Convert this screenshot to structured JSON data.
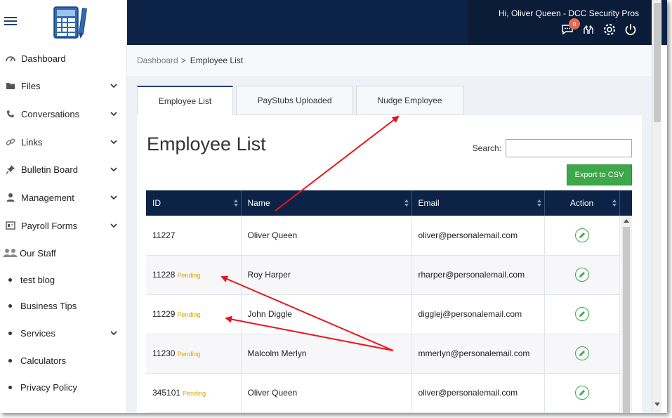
{
  "header": {
    "greeting": "Hi, Oliver Queen - DCC Security Pros",
    "notification_count": "0",
    "icons": [
      "chat-icon",
      "hands-icon",
      "gear-icon",
      "power-icon"
    ]
  },
  "sidebar": {
    "items": [
      {
        "label": "Dashboard",
        "icon": "gauge-icon",
        "has_chevron": false
      },
      {
        "label": "Files",
        "icon": "folder-icon",
        "has_chevron": true
      },
      {
        "label": "Conversations",
        "icon": "phone-icon",
        "has_chevron": true
      },
      {
        "label": "Links",
        "icon": "link-icon",
        "has_chevron": true
      },
      {
        "label": "Bulletin Board",
        "icon": "pin-icon",
        "has_chevron": true
      },
      {
        "label": "Management",
        "icon": "user-icon",
        "has_chevron": true
      },
      {
        "label": "Payroll Forms",
        "icon": "form-icon",
        "has_chevron": true
      },
      {
        "label": "Our Staff",
        "icon": "staff-icon",
        "has_chevron": false
      },
      {
        "label": "test blog",
        "icon": "bullet",
        "has_chevron": false
      },
      {
        "label": "Business Tips",
        "icon": "bullet",
        "has_chevron": false
      },
      {
        "label": "Services",
        "icon": "bullet",
        "has_chevron": true
      },
      {
        "label": "Calculators",
        "icon": "bullet",
        "has_chevron": false
      },
      {
        "label": "Privacy Policy",
        "icon": "bullet",
        "has_chevron": false
      }
    ]
  },
  "breadcrumb": {
    "parent": "Dashboard",
    "separator": ">",
    "current": "Employee List"
  },
  "tabs": [
    "Employee List",
    "PayStubs Uploaded",
    "Nudge Employee"
  ],
  "panel": {
    "title": "Employee List",
    "search_label": "Search:",
    "search_value": "",
    "export_label": "Export to CSV"
  },
  "table": {
    "columns": [
      "ID",
      "Name",
      "Email",
      "Action"
    ],
    "rows": [
      {
        "id": "11227",
        "status": "",
        "name": "Oliver Queen",
        "email": "oliver@personalemail.com"
      },
      {
        "id": "11228",
        "status": "Pending",
        "name": "Roy Harper",
        "email": "rharper@personalemail.com"
      },
      {
        "id": "11229",
        "status": "Pending",
        "name": "John Diggle",
        "email": "digglej@personalemail.com"
      },
      {
        "id": "11230",
        "status": "Pending",
        "name": "Malcolm Merlyn",
        "email": "mmerlyn@personalemail.com"
      },
      {
        "id": "345101",
        "status": "Pending",
        "name": "Oliver Queen",
        "email": "oliver@personalemail.com"
      }
    ]
  },
  "colors": {
    "header_bg": "#0c2347",
    "accent_green": "#3ca84a",
    "pending": "#e0a300",
    "annotation_arrow": "#e8151b"
  }
}
